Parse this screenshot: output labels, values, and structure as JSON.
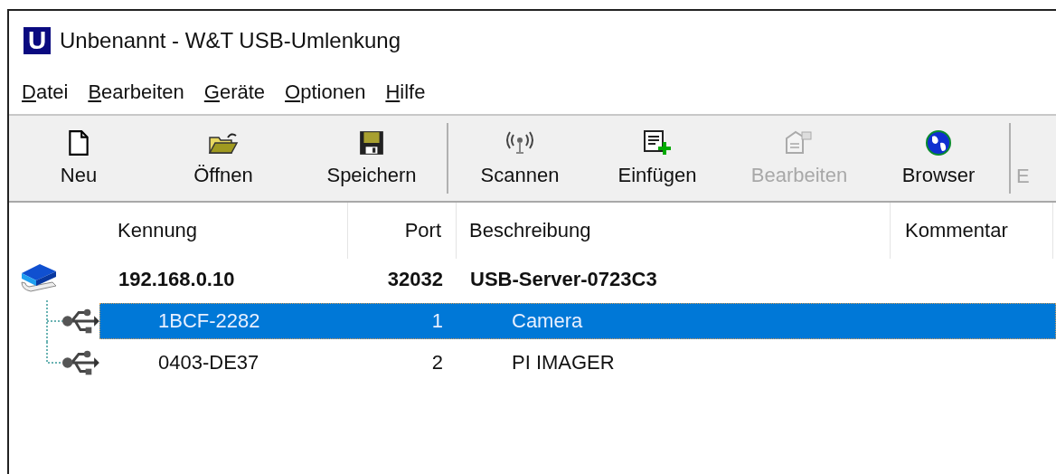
{
  "window": {
    "title": "Unbenannt - W&T USB-Umlenkung",
    "app_letter": "U"
  },
  "menu": [
    "Datei",
    "Bearbeiten",
    "Geräte",
    "Optionen",
    "Hilfe"
  ],
  "toolbar": [
    {
      "kind": "new",
      "label": "Neu",
      "disabled": false
    },
    {
      "kind": "open",
      "label": "Öffnen",
      "disabled": false
    },
    {
      "kind": "save",
      "label": "Speichern",
      "disabled": false
    },
    {
      "kind": "separator"
    },
    {
      "kind": "scan",
      "label": "Scannen",
      "disabled": false
    },
    {
      "kind": "insert",
      "label": "Einfügen",
      "disabled": false
    },
    {
      "kind": "edit",
      "label": "Bearbeiten",
      "disabled": true
    },
    {
      "kind": "browser",
      "label": "Browser",
      "disabled": false
    },
    {
      "kind": "separator"
    },
    {
      "kind": "cut",
      "label": "E",
      "disabled": true
    }
  ],
  "table": {
    "columns": [
      "Kennung",
      "Port",
      "Beschreibung",
      "Kommentar"
    ],
    "rows": [
      {
        "kind": "server",
        "kennung": "192.168.0.10",
        "port": "32032",
        "beschreibung": "USB-Server-0723C3",
        "selected": false,
        "children": [
          {
            "kind": "usb",
            "kennung": "1BCF-2282",
            "port": "1",
            "beschreibung": "Camera",
            "selected": true
          },
          {
            "kind": "usb",
            "kennung": "0403-DE37",
            "port": "2",
            "beschreibung": "PI IMAGER",
            "selected": false
          }
        ]
      }
    ]
  }
}
